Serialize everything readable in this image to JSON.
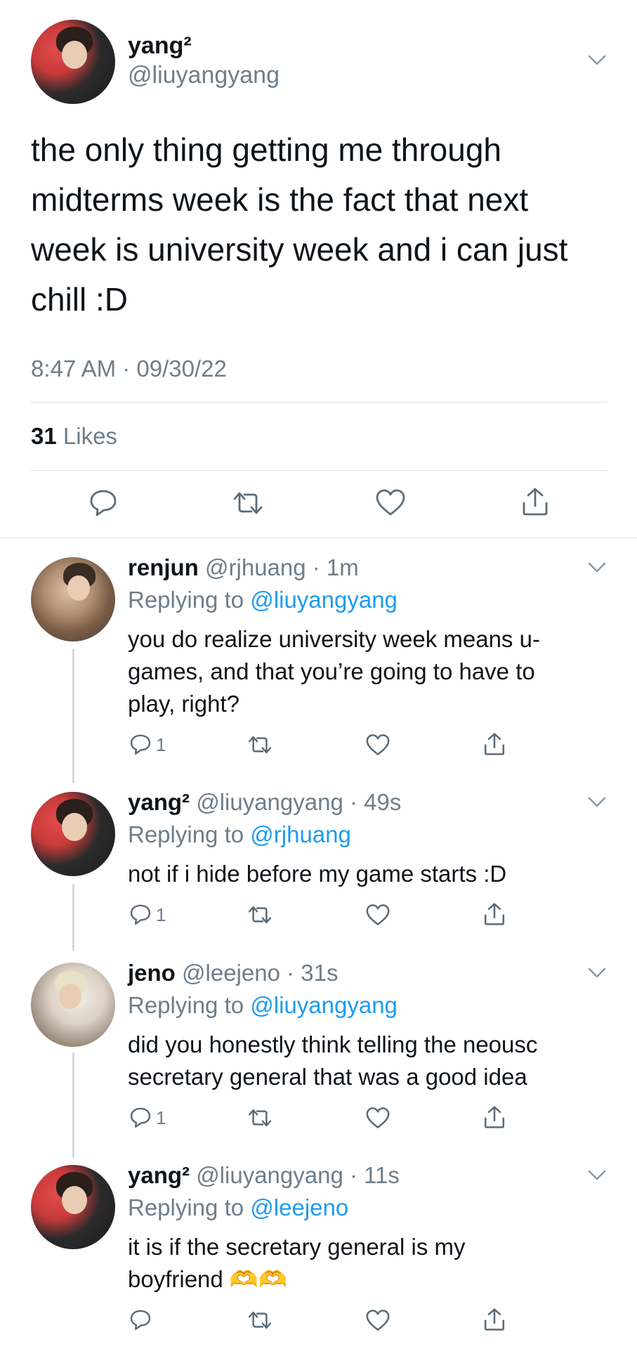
{
  "main_tweet": {
    "display_name": "yang²",
    "handle": "@liuyangyang",
    "text_lines": [
      "the only thing getting me through",
      "midterms week is the fact that next",
      "week is university week and i can just",
      "chill :D"
    ],
    "timestamp": "8:47 AM · 09/30/22",
    "likes_count": "31",
    "likes_label": "Likes"
  },
  "replies": [
    {
      "display_name": "renjun",
      "meta": "@rjhuang · 1m",
      "replying_prefix": "Replying to",
      "replying_to": "@liuyangyang",
      "text_lines": [
        "you do realize university week means u-",
        "games, and that you’re going to have to",
        "play, right?"
      ],
      "reply_count": "1"
    },
    {
      "display_name": "yang²",
      "meta": "@liuyangyang · 49s",
      "replying_prefix": "Replying to",
      "replying_to": "@rjhuang",
      "text_lines": [
        "not if i hide before my game starts :D"
      ],
      "reply_count": "1"
    },
    {
      "display_name": "jeno",
      "meta": "@leejeno · 31s",
      "replying_prefix": "Replying to",
      "replying_to": "@liuyangyang",
      "text_lines": [
        "did you honestly think telling the neousc",
        "secretary general that was a good idea"
      ],
      "reply_count": "1"
    },
    {
      "display_name": "yang²",
      "meta": "@liuyangyang · 11s",
      "replying_prefix": "Replying to",
      "replying_to": "@leejeno",
      "text_lines": [
        "it is if the secretary general is my",
        "boyfriend 🫶🫶"
      ],
      "reply_count": ""
    }
  ],
  "icons": {
    "reply": "reply-icon",
    "retweet": "retweet-icon",
    "like": "heart-icon",
    "share": "share-icon",
    "more": "chevron-down-icon"
  },
  "colors": {
    "text": "#0f1419",
    "secondary": "#6e7d8a",
    "link": "#1d9bf0",
    "divider": "#d8dee3"
  }
}
